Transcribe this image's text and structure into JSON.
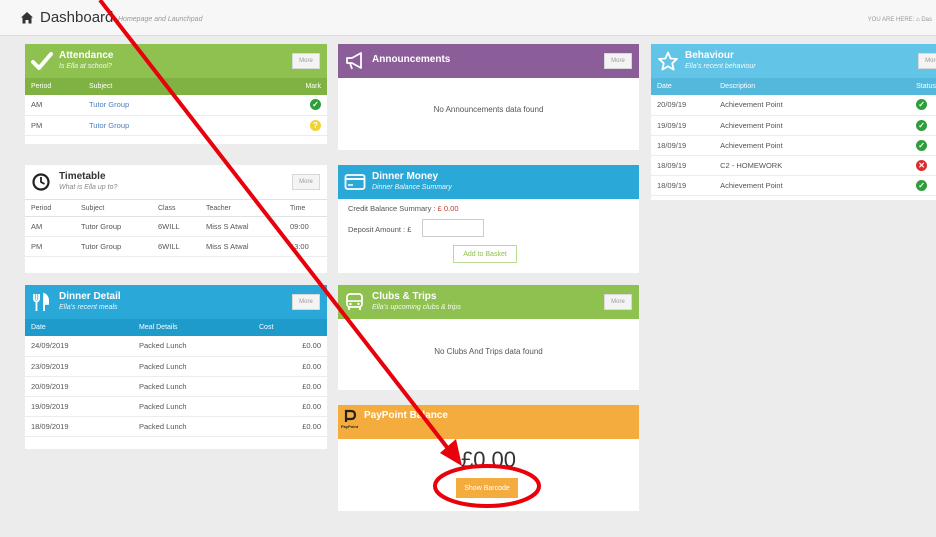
{
  "header": {
    "title": "Dashboard",
    "subtitle": "Homepage and Launchpad",
    "breadcrumb_label": "YOU ARE HERE:",
    "breadcrumb_item": "Das"
  },
  "more_label": "More",
  "attendance": {
    "title": "Attendance",
    "subtitle": "Is Ella at school?",
    "columns": [
      "Period",
      "Subject",
      "Mark"
    ],
    "rows": [
      {
        "period": "AM",
        "subject": "Tutor Group",
        "mark": "present"
      },
      {
        "period": "PM",
        "subject": "Tutor Group",
        "mark": "unknown"
      }
    ]
  },
  "timetable": {
    "title": "Timetable",
    "subtitle": "What is Ella up to?",
    "columns": [
      "Period",
      "Subject",
      "Class",
      "Teacher",
      "Time"
    ],
    "rows": [
      {
        "period": "AM",
        "subject": "Tutor Group",
        "class": "6WILL",
        "teacher": "Miss S Atwal",
        "time": "09:00"
      },
      {
        "period": "PM",
        "subject": "Tutor Group",
        "class": "6WILL",
        "teacher": "Miss S Atwal",
        "time": "13:00"
      }
    ]
  },
  "dinner_detail": {
    "title": "Dinner Detail",
    "subtitle": "Ella's recent meals",
    "columns": [
      "Date",
      "Meal Details",
      "Cost"
    ],
    "rows": [
      {
        "date": "24/09/2019",
        "meal": "Packed Lunch",
        "cost": "£0.00"
      },
      {
        "date": "23/09/2019",
        "meal": "Packed Lunch",
        "cost": "£0.00"
      },
      {
        "date": "20/09/2019",
        "meal": "Packed Lunch",
        "cost": "£0.00"
      },
      {
        "date": "19/09/2019",
        "meal": "Packed Lunch",
        "cost": "£0.00"
      },
      {
        "date": "18/09/2019",
        "meal": "Packed Lunch",
        "cost": "£0.00"
      }
    ]
  },
  "announcements": {
    "title": "Announcements",
    "empty": "No Announcements data found"
  },
  "dinner_money": {
    "title": "Dinner Money",
    "subtitle": "Dinner Balance Summary",
    "balance_label": "Credit Balance Summary :",
    "balance_value": "£ 0.00",
    "deposit_label": "Deposit Amount : £",
    "deposit_value": "",
    "add_button": "Add to Basket"
  },
  "clubs": {
    "title": "Clubs & Trips",
    "subtitle": "Ella's upcoming clubs & trips",
    "empty": "No Clubs And Trips data found"
  },
  "paypoint": {
    "title": "PayPoint Balance",
    "logo_text": "PayPoint",
    "amount": "£0.00",
    "button": "Show Barcode"
  },
  "behaviour": {
    "title": "Behaviour",
    "subtitle": "Ella's recent behaviour",
    "columns": [
      "Date",
      "Description",
      "Status"
    ],
    "rows": [
      {
        "date": "20/09/19",
        "description": "Achievement Point",
        "status": "positive"
      },
      {
        "date": "19/09/19",
        "description": "Achievement Point",
        "status": "positive"
      },
      {
        "date": "18/09/19",
        "description": "Achievement Point",
        "status": "positive"
      },
      {
        "date": "18/09/19",
        "description": "C2 - HOMEWORK",
        "status": "negative"
      },
      {
        "date": "18/09/19",
        "description": "Achievement Point",
        "status": "positive"
      }
    ]
  },
  "colors": {
    "green": "#8fc150",
    "purple": "#8b5e99",
    "cyan": "#2aa9d8",
    "orange": "#f4ac3f",
    "annotation_red": "#e8000b",
    "status_positive": "#2e9e3a",
    "status_negative": "#e02b2b",
    "status_unknown": "#f2d230"
  },
  "icons": {
    "home": "home-icon",
    "attendance": "checkmark-icon",
    "announcements": "megaphone-icon",
    "timetable": "clock-icon",
    "dinner_money": "card-icon",
    "dinner_detail": "cutlery-icon",
    "clubs": "bus-icon",
    "behaviour": "star-icon",
    "paypoint": "paypoint-logo-icon"
  }
}
